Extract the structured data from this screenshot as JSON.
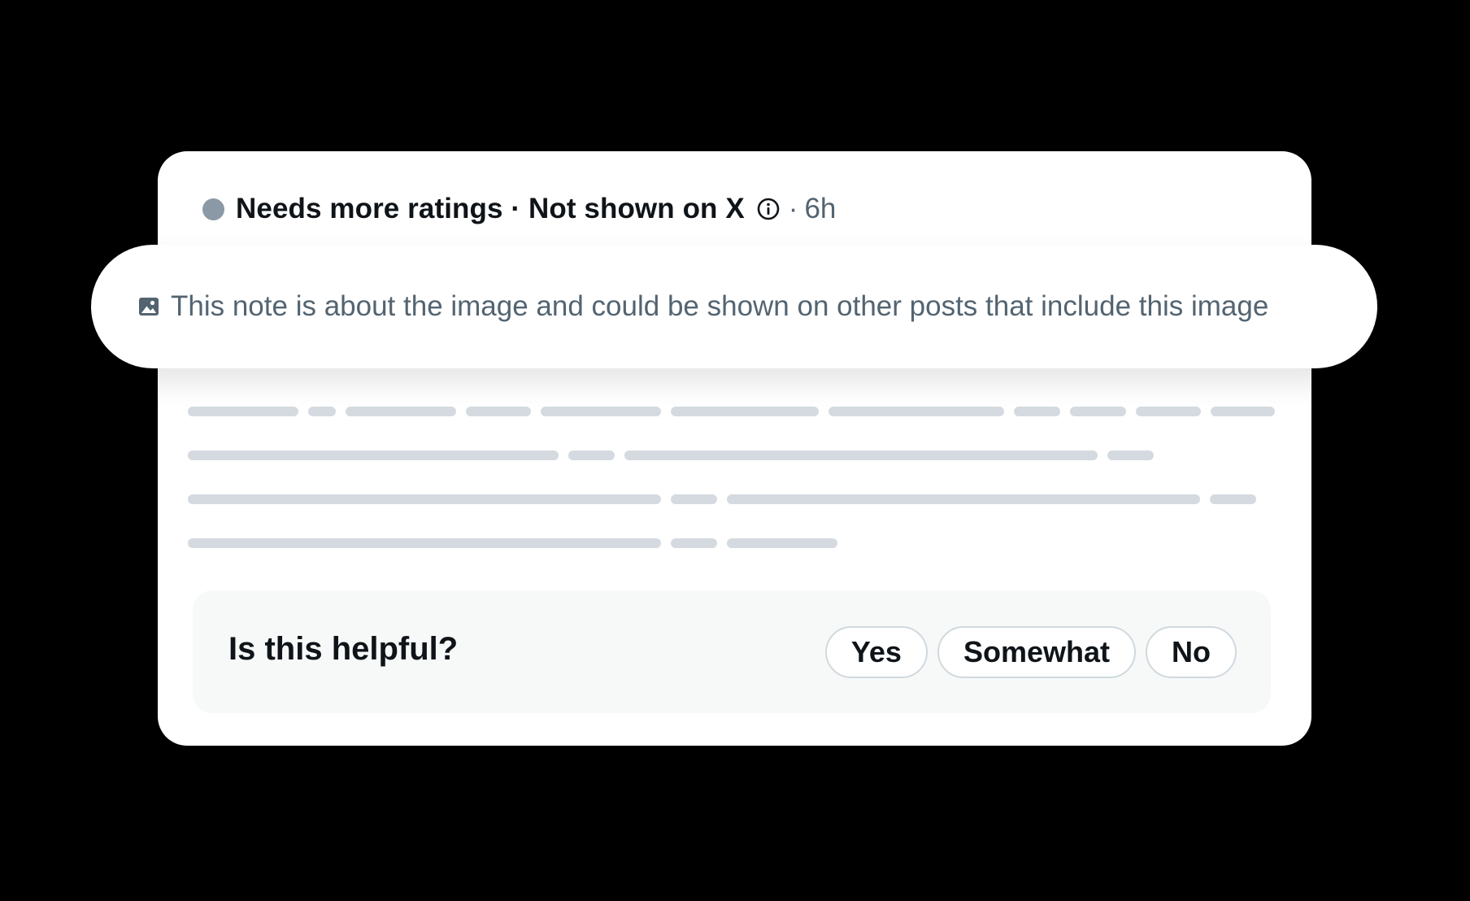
{
  "note_header": {
    "status_label": "Needs more ratings · Not shown on X",
    "separator": "·",
    "timestamp": "6h",
    "status_dot_color": "#8b98a5",
    "info_icon": "info-circle-icon"
  },
  "image_notice": {
    "icon": "image-icon",
    "text": "This note is about the image and could be shown on other posts that include this image"
  },
  "note_body": {
    "placeholder_line_count": 4
  },
  "helpful_prompt": {
    "question": "Is this helpful?",
    "options": [
      "Yes",
      "Somewhat",
      "No"
    ]
  },
  "colors": {
    "background": "#000000",
    "card": "#ffffff",
    "primary_text": "#0f1419",
    "secondary_text": "#536471",
    "skeleton": "#d4dadf"
  }
}
